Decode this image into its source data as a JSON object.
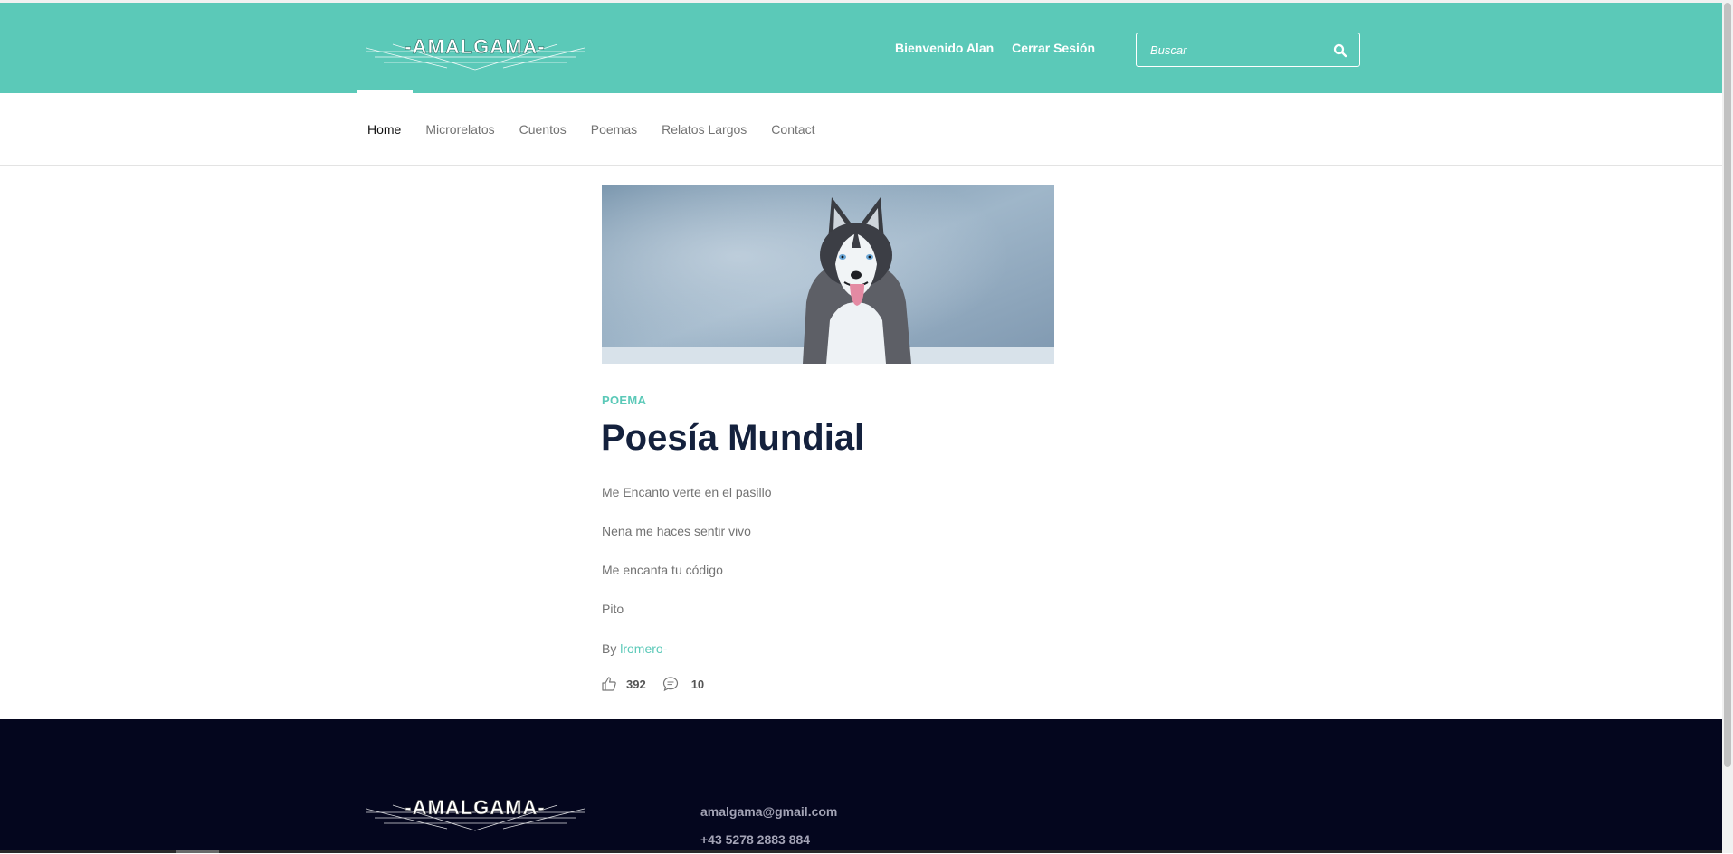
{
  "header": {
    "logo_text": "-AMALGAMA-",
    "welcome": "Bienvenido Alan",
    "logout": "Cerrar Sesión",
    "search_placeholder": "Buscar"
  },
  "nav": {
    "items": [
      {
        "label": "Home"
      },
      {
        "label": "Microrelatos"
      },
      {
        "label": "Cuentos"
      },
      {
        "label": "Poemas"
      },
      {
        "label": "Relatos Largos"
      },
      {
        "label": "Contact"
      }
    ],
    "active_index": 0
  },
  "post": {
    "category": "POEMA",
    "title": "Poesía Mundial",
    "lines": [
      "Me Encanto verte en el pasillo",
      "Nena me haces sentir vivo",
      "Me encanta tu código",
      "Pito"
    ],
    "by_label": "By",
    "author": "lromero-",
    "likes": "392",
    "comments": "10"
  },
  "footer": {
    "logo_text": "-AMALGAMA-",
    "email": "amalgama@gmail.com",
    "phone": "+43 5278 2883 884"
  },
  "colors": {
    "accent": "#5bc9b8",
    "heading": "#14213d",
    "footer_bg": "#04061e"
  }
}
